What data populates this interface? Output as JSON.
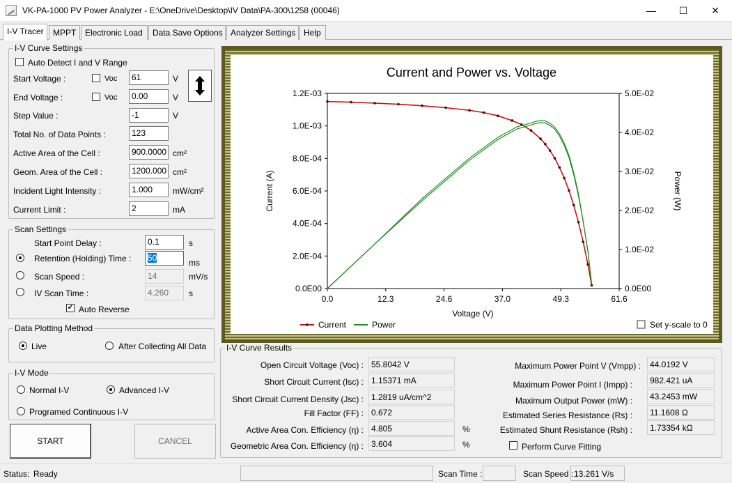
{
  "window": {
    "title": "VK-PA-1000 PV Power Analyzer - E:\\OneDrive\\Desktop\\IV Data\\PA-300\\1258 (00046)",
    "minimize": "—",
    "maximize": "☐",
    "close": "✕"
  },
  "tabs": [
    "I-V Tracer",
    "MPPT",
    "Electronic Load",
    "Data Save Options",
    "Analyzer Settings",
    "Help"
  ],
  "iv_settings": {
    "group_label": "I-V Curve Settings",
    "auto_detect_label": "Auto Detect I and V Range",
    "auto_detect_checked": false,
    "start_voltage_label": "Start Voltage :",
    "end_voltage_label": "End Voltage :",
    "voc_label": "Voc",
    "step_value_label": "Step Value :",
    "total_points_label": "Total No. of Data Points :",
    "active_area_label": "Active Area of the Cell :",
    "geom_area_label": "Geom. Area of the Cell :",
    "light_intensity_label": "Incident Light Intensity :",
    "current_limit_label": "Current Limit :",
    "start_voltage": "61",
    "end_voltage": "0.00",
    "step_value": "-1",
    "total_points": "123",
    "active_area": "900.0000",
    "geom_area": "1200.000",
    "light_intensity": "1.000",
    "current_limit": "2",
    "unit_v": "V",
    "unit_cm2": "cm²",
    "unit_mwcm2": "mW/cm²",
    "unit_ma": "mA",
    "swap_icon": "up-down-arrow"
  },
  "scan_settings": {
    "group_label": "Scan Settings",
    "start_delay_label": "Start Point Delay :",
    "start_delay": "0.1",
    "start_delay_unit": "s",
    "retention_label": "Retention (Holding) Time :",
    "retention": "50",
    "retention_unit": "ms",
    "scan_speed_label": "Scan Speed :",
    "scan_speed": "14",
    "scan_speed_unit": "mV/s",
    "iv_scan_time_label": "IV Scan Time :",
    "iv_scan_time": "4.260",
    "iv_scan_time_unit": "s",
    "auto_reverse_label": "Auto Reverse",
    "auto_reverse_checked": true
  },
  "plotting": {
    "group_label": "Data Plotting Method",
    "live_label": "Live",
    "after_label": "After Collecting All Data"
  },
  "iv_mode": {
    "group_label": "I-V Mode",
    "normal_label": "Normal I-V",
    "advanced_label": "Advanced I-V",
    "continuous_label": "Programed Continuous I-V"
  },
  "buttons": {
    "start": "START",
    "cancel": "CANCEL"
  },
  "chart_data": {
    "type": "line",
    "title": "Current and Power vs. Voltage",
    "xlabel": "Voltage (V)",
    "ylabel": "Current (A)",
    "y2label": "Power (W)",
    "xlim": [
      0,
      61.6
    ],
    "ylim": [
      0,
      0.0012
    ],
    "y2lim": [
      0,
      0.05
    ],
    "x_ticks": [
      "0.0",
      "12.3",
      "24.6",
      "37.0",
      "49.3",
      "61.6"
    ],
    "y_ticks": [
      "0.0E00",
      "2.0E-04",
      "4.0E-04",
      "6.0E-04",
      "8.0E-04",
      "1.0E-03",
      "1.2E-03"
    ],
    "y2_ticks": [
      "0.0E00",
      "1.0E-02",
      "2.0E-02",
      "3.0E-02",
      "4.0E-02",
      "5.0E-02"
    ],
    "legend_position": "bottom-left",
    "set_yscale_label": "Set y-scale to 0",
    "series": [
      {
        "name": "Current",
        "color": "#cc1111",
        "axis": "left",
        "x": [
          0,
          5,
          10,
          15,
          20,
          25,
          30,
          33,
          36,
          39,
          41,
          43,
          45,
          46,
          47,
          48,
          49,
          50,
          51,
          52,
          53,
          54,
          55,
          55.8
        ],
        "y": [
          0.00115,
          0.001146,
          0.00114,
          0.001133,
          0.001124,
          0.001112,
          0.001096,
          0.001082,
          0.001062,
          0.001033,
          0.001008,
          0.000972,
          0.000921,
          0.000888,
          0.000848,
          0.000801,
          0.000745,
          0.00068,
          0.000603,
          0.000513,
          0.000408,
          0.000287,
          0.000148,
          2e-05
        ]
      },
      {
        "name": "Power",
        "color": "#1e8c1e",
        "axis": "right",
        "x": [
          0,
          10,
          20,
          30,
          36,
          40,
          43,
          44,
          45,
          46,
          47,
          48,
          49,
          50,
          51,
          52,
          53,
          54,
          55,
          55.8
        ],
        "y": [
          0,
          0.0114,
          0.0225,
          0.0329,
          0.0382,
          0.0409,
          0.0419,
          0.0423,
          0.0425,
          0.0424,
          0.0418,
          0.0408,
          0.0391,
          0.0367,
          0.0336,
          0.0292,
          0.0238,
          0.0172,
          0.0096,
          0.0011
        ]
      }
    ]
  },
  "results": {
    "group_label": "I-V Curve Results",
    "voc_label": "Open Circuit Voltage (Voc) :",
    "voc": "55.8042 V",
    "isc_label": "Short Circuit Current (Isc) :",
    "isc": "1.15371 mA",
    "jsc_label": "Short Circuit Current Density (Jsc) :",
    "jsc": "1.2819 uA/cm^2",
    "ff_label": "Fill Factor (FF) :",
    "ff": "0.672",
    "active_eff_label": "Active Area Con. Efficiency (η) :",
    "active_eff": "4.805",
    "geom_eff_label": "Geometric Area Con. Efficiency (η) :",
    "geom_eff": "3.604",
    "percent": "%",
    "vmpp_label": "Maximum Power Point V (Vmpp) :",
    "vmpp": "44.0192 V",
    "impp_label": "Maximum Power Point I (Impp) :",
    "impp": "982.421 uA",
    "pmax_label": "Maximum Output Power (mW) :",
    "pmax": "43.2453 mW",
    "rs_label": "Estimated Series Resistance (Rs) :",
    "rs": "11.1608 Ω",
    "rsh_label": "Estimated Shunt Resistance (Rsh) :",
    "rsh": "1.73354 kΩ",
    "curve_fitting_label": "Perform Curve Fitting"
  },
  "status": {
    "status_label": "Status:",
    "status_value": "Ready",
    "scan_time_label": "Scan Time :",
    "scan_time": "",
    "scan_speed_label": "Scan Speed :",
    "scan_speed": "13.261 V/s"
  }
}
